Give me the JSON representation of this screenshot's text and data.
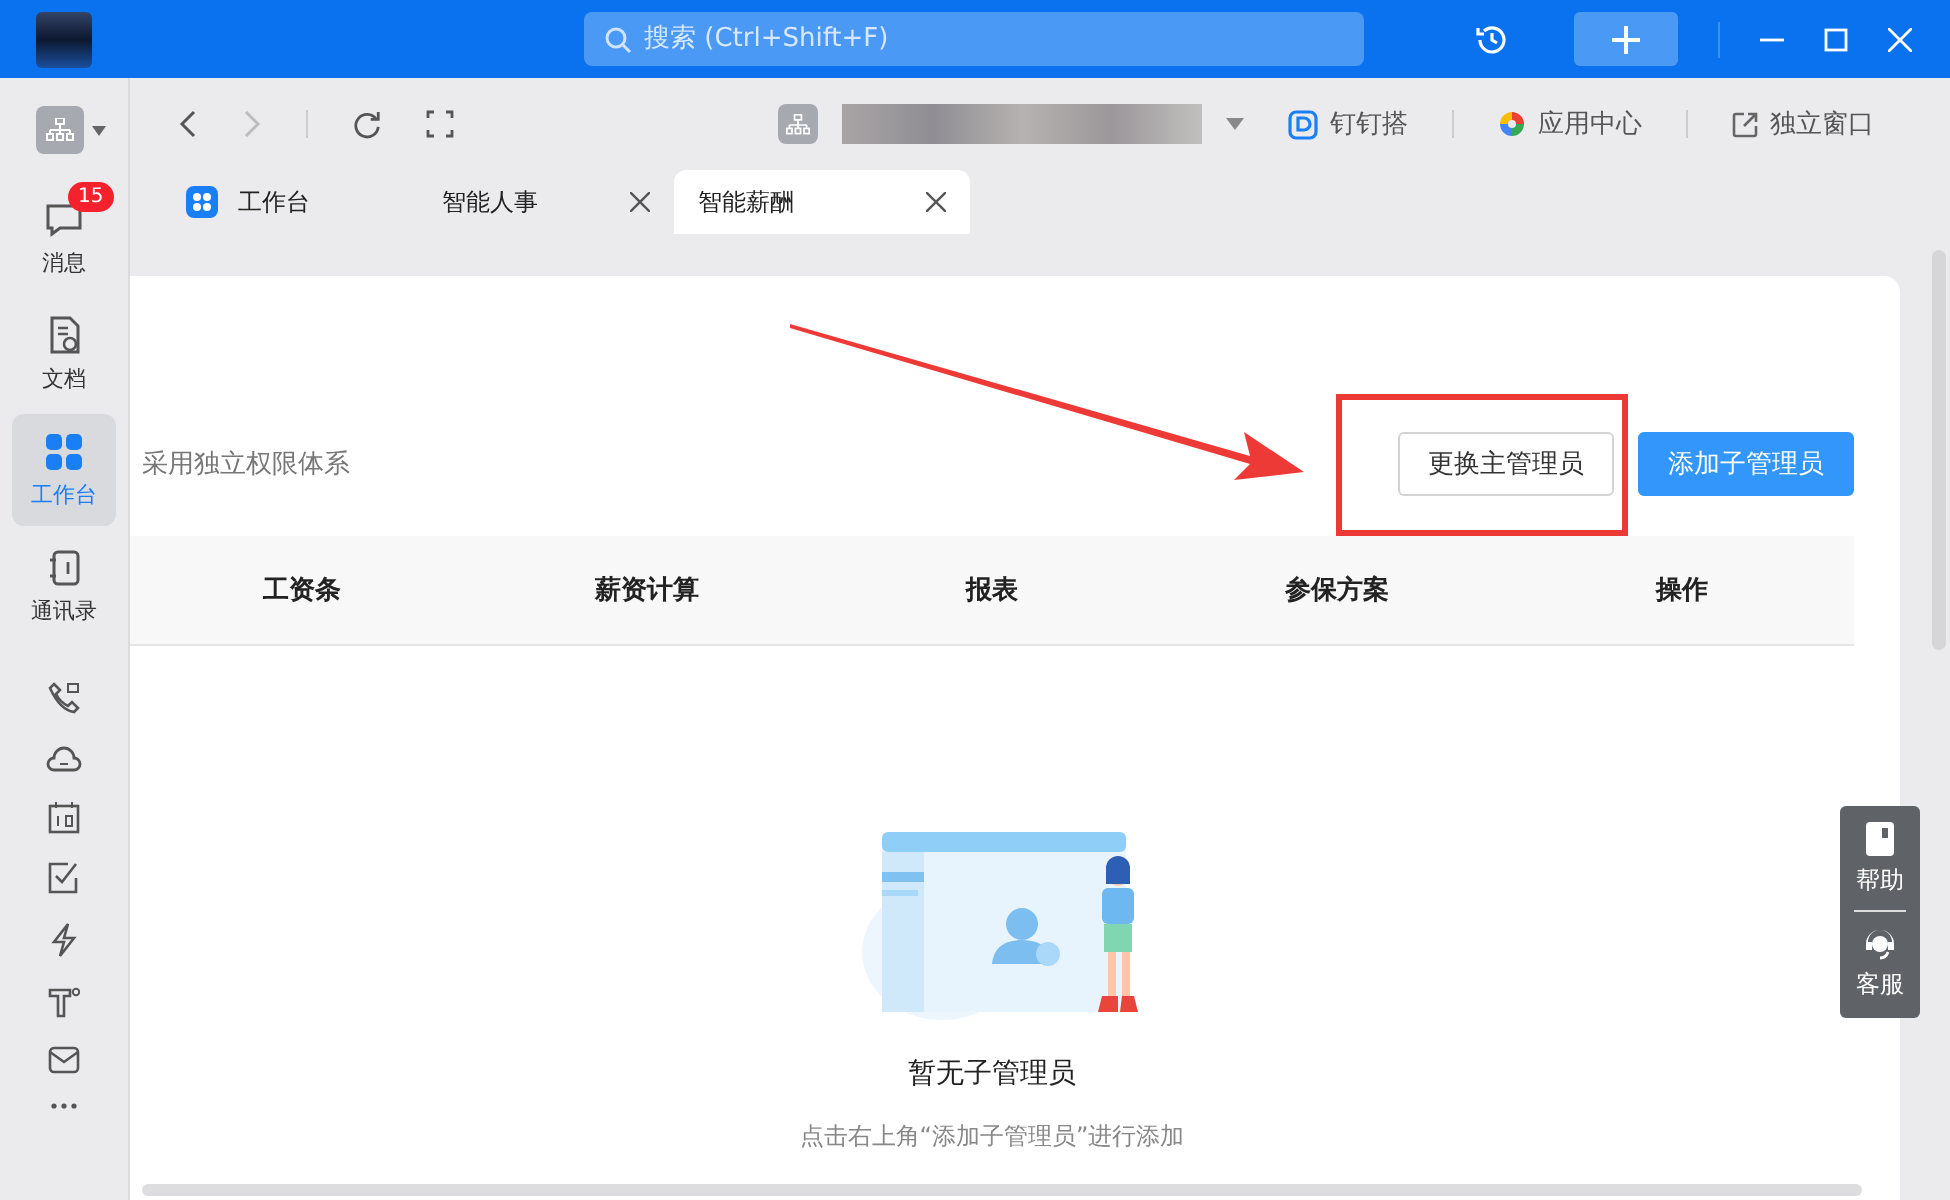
{
  "title_bar": {
    "search": {
      "placeholder": "搜索 (Ctrl+Shift+F)"
    }
  },
  "sidebar": {
    "items": [
      {
        "label": "消息",
        "badge": "15",
        "selected": false
      },
      {
        "label": "文档",
        "selected": false
      },
      {
        "label": "工作台",
        "selected": true
      },
      {
        "label": "通讯录",
        "selected": false
      }
    ]
  },
  "toolbar": {
    "links": [
      "钉钉搭",
      "应用中心",
      "独立窗口"
    ]
  },
  "tabs": [
    {
      "label": "工作台",
      "selected": false,
      "closable": false
    },
    {
      "label": "智能人事",
      "selected": false,
      "closable": true
    },
    {
      "label": "智能薪酬",
      "selected": true,
      "closable": true
    }
  ],
  "page": {
    "description": "采用独立权限体系",
    "buttons": [
      {
        "label": "更换主管理员",
        "kind": "secondary"
      },
      {
        "label": "添加子管理员",
        "kind": "primary"
      }
    ]
  },
  "table": {
    "columns": [
      "工资条",
      "薪资计算",
      "报表",
      "参保方案",
      "操作"
    ]
  },
  "empty_state": {
    "title": "暂无子管理员",
    "hint": "点击右上角“添加子管理员”进行添加"
  },
  "float_panel": {
    "items": [
      "帮助",
      "客服"
    ]
  }
}
